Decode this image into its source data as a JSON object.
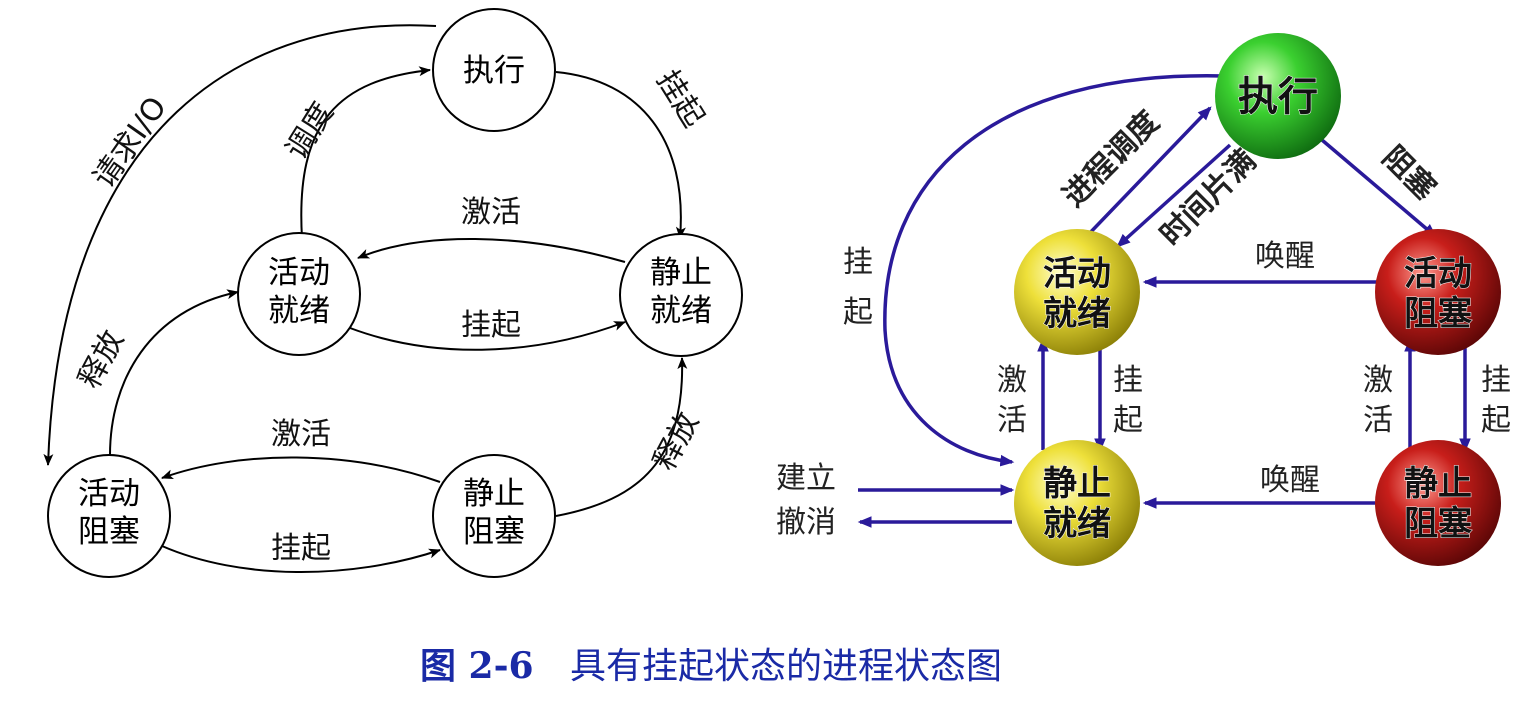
{
  "left_diagram": {
    "nodes": {
      "exec": [
        "执行"
      ],
      "active_ready": [
        "活动",
        "就绪"
      ],
      "static_ready": [
        "静止",
        "就绪"
      ],
      "active_blocked": [
        "活动",
        "阻塞"
      ],
      "static_blocked": [
        "静止",
        "阻塞"
      ]
    },
    "edges": {
      "request_io": "请求I/O",
      "dispatch": "调度",
      "suspend_exec": "挂起",
      "activate_top": "激活",
      "suspend_mid": "挂起",
      "release_left": "释放",
      "activate_bottom": "激活",
      "suspend_bottom": "挂起",
      "release_right": "释放"
    }
  },
  "right_diagram": {
    "nodes": {
      "exec": [
        "执行"
      ],
      "active_ready": [
        "活动",
        "就绪"
      ],
      "active_blocked": [
        "活动",
        "阻塞"
      ],
      "static_ready": [
        "静止",
        "就绪"
      ],
      "static_blocked": [
        "静止",
        "阻塞"
      ]
    },
    "edges": {
      "dispatch": "进程调度",
      "timeslice": "时间片满",
      "block": "阻塞",
      "suspend_left": [
        "挂",
        "起"
      ],
      "wakeup_top": "唤醒",
      "activate_left": [
        "激",
        "活"
      ],
      "suspend_mid": [
        "挂",
        "起"
      ],
      "activate_right": [
        "激",
        "活"
      ],
      "suspend_right": [
        "挂",
        "起"
      ],
      "wakeup_bottom": "唤醒",
      "create": "建立",
      "cancel": "撤消"
    },
    "colors": {
      "arrow": "#2a1a9a",
      "exec_fill": "#22b020",
      "ready_fill": "#e6dc1e",
      "blocked_fill": "#b01414"
    }
  },
  "caption": {
    "number": "图 2-6",
    "text": "具有挂起状态的进程状态图"
  }
}
